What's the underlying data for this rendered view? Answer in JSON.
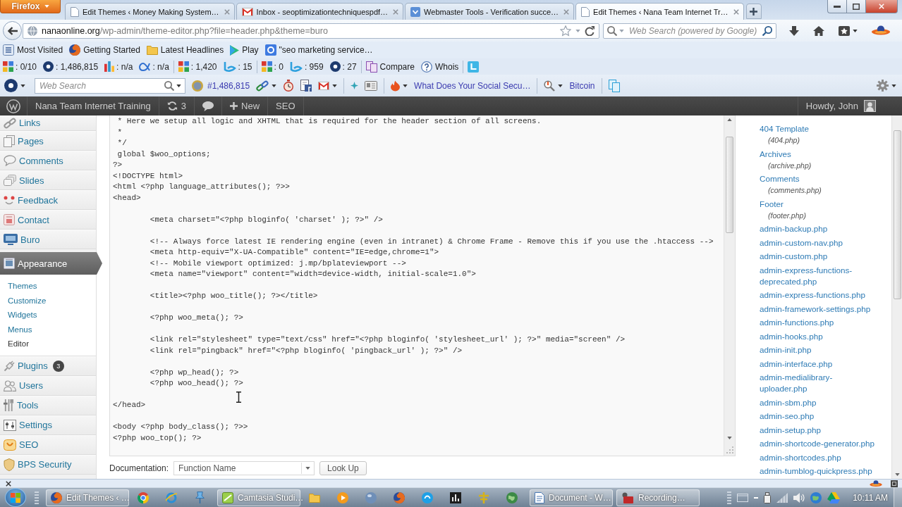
{
  "browser": {
    "menu_button": "Firefox",
    "tabs": [
      {
        "title": "Edit Themes ‹ Money Making System…",
        "selected": false
      },
      {
        "title": "Inbox - seoptimizationtechniquespdf…",
        "selected": false
      },
      {
        "title": "Webmaster Tools - Verification succe…",
        "selected": false
      },
      {
        "title": "Edit Themes ‹ Nana Team Internet Tr…",
        "selected": true
      }
    ],
    "address": {
      "host": "nanaonline.org",
      "path": "/wp-admin/theme-editor.php?file=header.php&theme=buro"
    },
    "search": {
      "placeholder": "Web Search (powered by Google)"
    },
    "bookmarks": [
      "Most Visited",
      "Getting Started",
      "Latest Headlines",
      "Play",
      "\"seo marketing service…"
    ],
    "seo_toolbar": {
      "stat_groups": [
        [
          ": 0/10",
          ": 1,486,815",
          ": n/a",
          ": n/a"
        ],
        [
          ": 1,420",
          ": 15"
        ],
        [
          ": 0",
          ": 959",
          ": 27"
        ]
      ],
      "links": [
        "Compare",
        "Whois"
      ]
    },
    "toolbar": {
      "search": {
        "placeholder": "Web Search"
      },
      "rank": "#1,486,815",
      "links": [
        "What Does Your Social Secu…",
        "Bitcoin"
      ]
    }
  },
  "admin_bar": {
    "site_name": "Nana Team Internet Training",
    "updates": "3",
    "new": "New",
    "seo": "SEO",
    "greeting": "Howdy, John"
  },
  "menu": [
    {
      "label": "Links",
      "selected": false
    },
    {
      "label": "Pages",
      "selected": false
    },
    {
      "label": "Comments",
      "selected": false
    },
    {
      "label": "Slides",
      "selected": false
    },
    {
      "label": "Feedback",
      "selected": false
    },
    {
      "label": "Contact",
      "selected": false
    },
    {
      "label": "Buro",
      "selected": false
    },
    {
      "label": "Appearance",
      "selected": true,
      "submenu": [
        {
          "label": "Themes",
          "selected": false
        },
        {
          "label": "Customize",
          "selected": false
        },
        {
          "label": "Widgets",
          "selected": false
        },
        {
          "label": "Menus",
          "selected": false
        },
        {
          "label": "Editor",
          "selected": true
        }
      ]
    },
    {
      "label": "Plugins",
      "selected": false,
      "badge": "3"
    },
    {
      "label": "Users",
      "selected": false
    },
    {
      "label": "Tools",
      "selected": false
    },
    {
      "label": "Settings",
      "selected": false
    },
    {
      "label": "SEO",
      "selected": false
    },
    {
      "label": "BPS Security",
      "selected": false
    }
  ],
  "editor": {
    "code": " * Here we setup all logic and XHTML that is required for the header section of all screens.\n *\n */\n global $woo_options;\n?>\n<!DOCTYPE html>\n<html <?php language_attributes(); ?>>\n<head>\n\n\t<meta charset=\"<?php bloginfo( 'charset' ); ?>\" />\n\n\t<!-- Always force latest IE rendering engine (even in intranet) & Chrome Frame - Remove this if you use the .htaccess -->\n\t<meta http-equiv=\"X-UA-Compatible\" content=\"IE=edge,chrome=1\">\n\t<!-- Mobile viewport optimized: j.mp/bplateviewport -->\n\t<meta name=\"viewport\" content=\"width=device-width, initial-scale=1.0\">\n\n\t<title><?php woo_title(); ?></title>\n\n\t<?php woo_meta(); ?>\n\n\t<link rel=\"stylesheet\" type=\"text/css\" href=\"<?php bloginfo( 'stylesheet_url' ); ?>\" media=\"screen\" />\n\t<link rel=\"pingback\" href=\"<?php bloginfo( 'pingback_url' ); ?>\" />\n\n\t<?php wp_head(); ?>\n\t<?php woo_head(); ?>\n\n</head>\n\n<body <?php body_class(); ?>>\n<?php woo_top(); ?>",
    "documentation": {
      "label": "Documentation:",
      "select": "Function Name",
      "button": "Look Up"
    }
  },
  "templates": [
    {
      "name": "404 Template",
      "file": "(404.php)"
    },
    {
      "name": "Archives",
      "file": "(archive.php)"
    },
    {
      "name": "Comments",
      "file": "(comments.php)"
    },
    {
      "name": "Footer",
      "file": "(footer.php)"
    },
    {
      "name": "admin-backup.php"
    },
    {
      "name": "admin-custom-nav.php"
    },
    {
      "name": "admin-custom.php"
    },
    {
      "name": "admin-express-functions-deprecated.php"
    },
    {
      "name": "admin-express-functions.php"
    },
    {
      "name": "admin-framework-settings.php"
    },
    {
      "name": "admin-functions.php"
    },
    {
      "name": "admin-hooks.php"
    },
    {
      "name": "admin-init.php"
    },
    {
      "name": "admin-interface.php"
    },
    {
      "name": "admin-medialibrary-uploader.php"
    },
    {
      "name": "admin-sbm.php"
    },
    {
      "name": "admin-seo.php"
    },
    {
      "name": "admin-setup.php"
    },
    {
      "name": "admin-shortcode-generator.php"
    },
    {
      "name": "admin-shortcodes.php"
    },
    {
      "name": "admin-tumblog-quickpress.php"
    }
  ],
  "taskbar": {
    "windows": [
      "Edit Themes ‹ …",
      "Camtasia Studi…",
      "Document - W…",
      "Recording…"
    ],
    "clock": "10:11 AM"
  }
}
